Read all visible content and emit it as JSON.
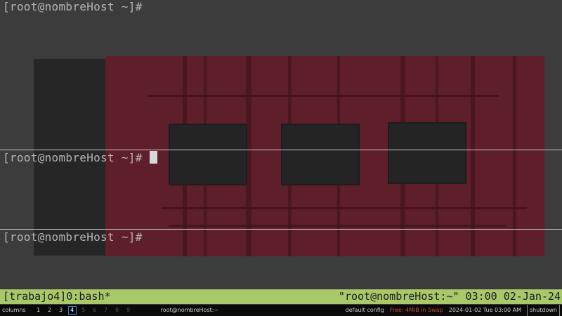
{
  "panes": [
    {
      "prompt": "[root@nombreHost ~]#",
      "has_cursor": false
    },
    {
      "prompt": "[root@nombreHost ~]#",
      "has_cursor": true
    },
    {
      "prompt": "[root@nombreHost ~]#",
      "has_cursor": false
    }
  ],
  "tmux": {
    "left": "[trabajo4]0:bash*",
    "right": "\"root@nombreHost:~\" 03:00 02-Jan-24",
    "color": "#a9c86a"
  },
  "wm_bar": {
    "layout": "columns",
    "workspaces": [
      {
        "label": "1",
        "active": false,
        "dim": false
      },
      {
        "label": "2",
        "active": false,
        "dim": false
      },
      {
        "label": "3",
        "active": false,
        "dim": false
      },
      {
        "label": "4",
        "active": true,
        "dim": false
      },
      {
        "label": "5",
        "active": false,
        "dim": true
      },
      {
        "label": "6",
        "active": false,
        "dim": true
      },
      {
        "label": "7",
        "active": false,
        "dim": true
      },
      {
        "label": "8",
        "active": false,
        "dim": true
      },
      {
        "label": "9",
        "active": false,
        "dim": true
      }
    ],
    "window_title": "root@nombreHost:~",
    "config": "default config",
    "memory": "Free: 4MiB in Swap",
    "datetime": "2024-01-02 Tue 03:00 AM",
    "shutdown": "shutdown"
  },
  "colors": {
    "wallpaper_board": "#5e1f2a",
    "background": "#3a3a3a",
    "memory_warning": "#c44a3a",
    "active_workspace_border": "#4a7ac8"
  }
}
